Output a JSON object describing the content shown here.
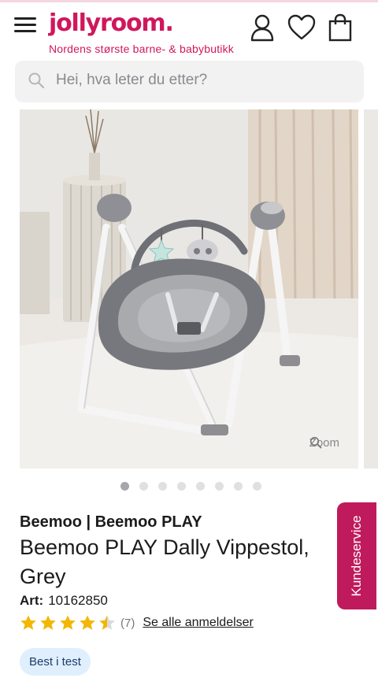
{
  "header": {
    "logo_text": "jollyroom.",
    "tagline": "Nordens største barne- & babybutikk",
    "brand_color": "#d0175c",
    "icons": [
      "menu-icon",
      "account-icon",
      "heart-icon",
      "shopping-bag-icon"
    ]
  },
  "search": {
    "placeholder": "Hei, hva leter du etter?",
    "icon": "search-icon"
  },
  "gallery": {
    "zoom_label": "Zoom",
    "image_count": 8,
    "active_index": 0
  },
  "product": {
    "brand": "Beemoo | Beemoo PLAY",
    "title": "Beemoo PLAY Dally Vippestol, Grey",
    "art_label": "Art:",
    "art_number": "10162850",
    "rating": 4.5,
    "rating_max": 5,
    "review_count": "(7)",
    "reviews_link": "Se alle anmeldelser",
    "badge": "Best i test"
  },
  "customer_service": {
    "label": "Kundeservice",
    "color": "#bf1a5c"
  }
}
